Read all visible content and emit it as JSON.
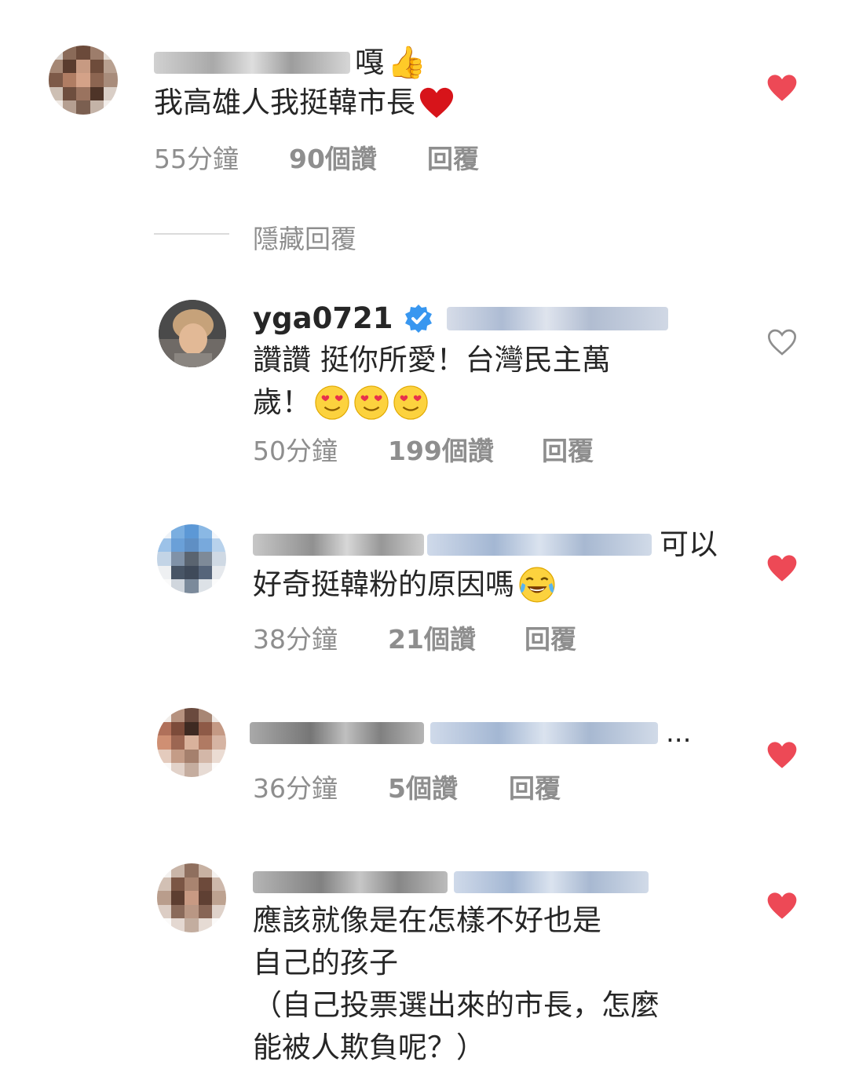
{
  "comments": [
    {
      "text_prefix": "嘎",
      "text": "我高雄人我挺韓市長",
      "time": "55分鐘",
      "likes": "90個讚",
      "reply": "回覆",
      "liked": true
    },
    {
      "username": "yga0721",
      "text_line1": "讚讚 挺你所愛！台灣民主萬",
      "text_line2": "歲！",
      "time": "50分鐘",
      "likes": "199個讚",
      "reply": "回覆",
      "liked": false
    },
    {
      "text_suffix": "可以",
      "text": "好奇挺韓粉的原因嗎",
      "time": "38分鐘",
      "likes": "21個讚",
      "reply": "回覆",
      "liked": true
    },
    {
      "ellipsis": "...",
      "time": "36分鐘",
      "likes": "5個讚",
      "reply": "回覆",
      "liked": true
    },
    {
      "text_line1": "應該就像是在怎樣不好也是",
      "text_line2": "自己的孩子",
      "text_line3": "（自己投票選出來的市長，怎麼",
      "text_line4": "能被人欺負呢？）",
      "liked": true
    }
  ],
  "hide_replies": "隱藏回覆",
  "colors": {
    "heart_red": "#ed4956",
    "meta_gray": "#8e8e8e",
    "verified_blue": "#3897f0"
  }
}
